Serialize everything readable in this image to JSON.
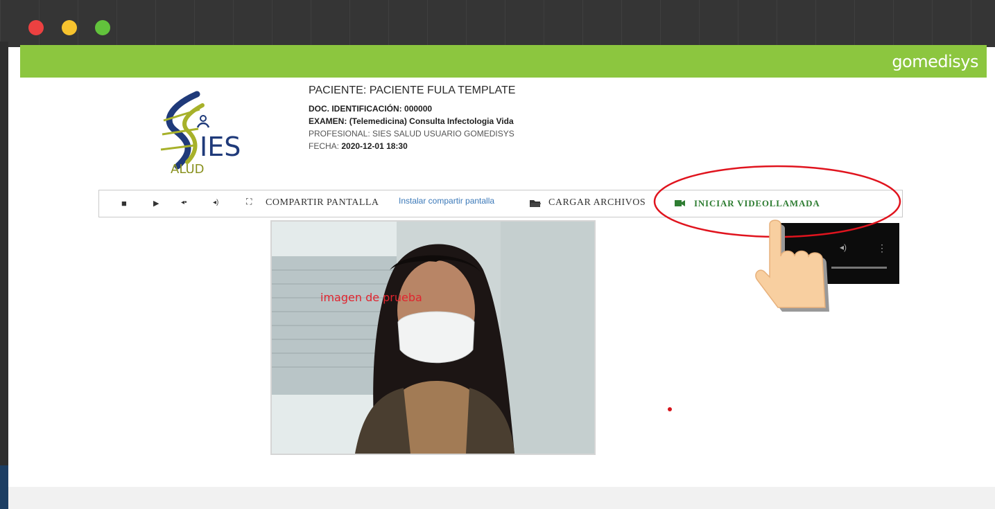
{
  "window": {
    "controls": [
      {
        "name": "close",
        "color": "#ec4141"
      },
      {
        "name": "minimize",
        "color": "#f7c32e"
      },
      {
        "name": "maximize",
        "color": "#62c23c"
      }
    ]
  },
  "header": {
    "brand": "gomedisys",
    "bar_color": "#8cc63f"
  },
  "logo": {
    "text_main": "IES",
    "text_sub": "ALUD"
  },
  "patient_info": {
    "patient": "PACIENTE: PACIENTE FULA TEMPLATE",
    "doc_label": "DOC. IDENTIFICACIÓN:",
    "doc_value": "000000",
    "exam_label": "EXAMEN:",
    "exam_value": "(Telemedicina) Consulta Infectologia Vida",
    "professional": "PROFESIONAL: SIES SALUD USUARIO GOMEDISYS",
    "date_label": "FECHA:",
    "date_value": "2020-12-01 18:30"
  },
  "toolbar": {
    "icons": [
      "stop-icon",
      "play-icon",
      "volume-down-icon",
      "volume-up-icon",
      "fullscreen-icon"
    ],
    "share_screen": "COMPARTIR  PANTALLA",
    "install_share": "Instalar compartir pantalla",
    "upload_files": "CARGAR  ARCHIVOS",
    "start_video_call": "INICIAR  VIDEOLLAMADA"
  },
  "video": {
    "overlay_text": "imagen de prueba"
  },
  "colors": {
    "annotation_ellipse": "#e0141e",
    "link": "#3a78b8",
    "video_call": "#2e7d32"
  }
}
